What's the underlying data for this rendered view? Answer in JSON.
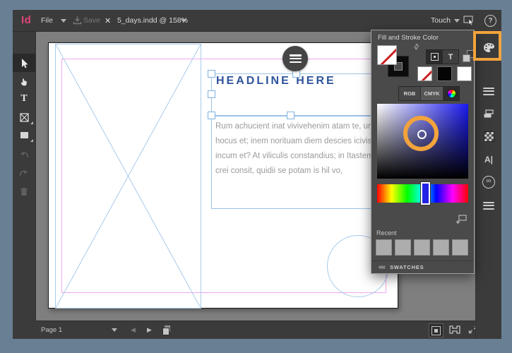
{
  "title_bar": {
    "logo": "Id",
    "file_menu": "File",
    "save_label": "Save",
    "document_title": "5_days.indd @ 158%",
    "mode": "Touch",
    "help": "?"
  },
  "panel": {
    "title": "Fill and Stroke Color",
    "color_modes": [
      "RGB",
      "CMYK"
    ],
    "type_toggle_glyph": "T",
    "recent_label": "Recent",
    "swatches_label": "SWATCHES",
    "recent_swatch_count": 5
  },
  "canvas": {
    "headline": "HEADLINE HERE",
    "body_lines": [
      "Rum achucient inat vivivehenim atam te, untem i",
      "hocus et; inem norituam diem descies icivis consu",
      "incum et? At viliculis constandius; in Itastem dit; h",
      "crei consit, quidii se potam is hil vo,"
    ]
  },
  "toolbar": {
    "type_tool_glyph": "T"
  },
  "sidebar": {
    "character_glyph": "A|",
    "cc_glyph": "∞"
  },
  "status_bar": {
    "page_label": "Page 1"
  },
  "glyphs": {
    "close": "✕",
    "swap": "⇄",
    "prev": "◀",
    "next": "▶",
    "chevrons_left": "««",
    "question": "?"
  },
  "colors": {
    "headline_blue": "#2E539C",
    "guide_pink": "#EFA9EF",
    "guide_blue": "#A9CBEA",
    "highlight_orange": "#F2A33C",
    "logo_pink": "#E0457B",
    "body_text_gray": "#9B9B9B",
    "current_hue": "#1A1AF0"
  }
}
